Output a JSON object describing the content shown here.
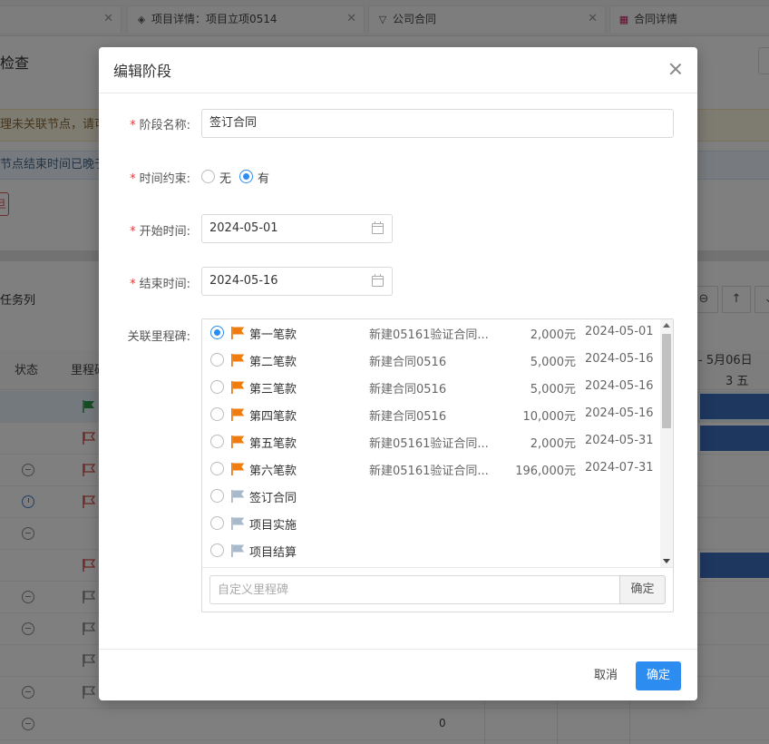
{
  "background": {
    "tabs": [
      {
        "label": ""
      },
      {
        "label": "项目详情：项目立项0514"
      },
      {
        "label": "公司合同"
      },
      {
        "label": "合同详情"
      }
    ],
    "page_title": "检查",
    "warning_text": "理未关联节点，请可",
    "info_text": "节点结束时间已晚于",
    "task_list_label": "任务列",
    "col_status": "状态",
    "col_milestone": "里程碑",
    "date_header": "- 5月06日",
    "day_header": "3  五",
    "bottom_value": "0"
  },
  "modal": {
    "title": "编辑阶段",
    "fields": {
      "stage_name": {
        "label": "阶段名称:",
        "value": "签订合同"
      },
      "time_constraint": {
        "label": "时间约束:",
        "options": [
          {
            "label": "无",
            "selected": false
          },
          {
            "label": "有",
            "selected": true
          }
        ]
      },
      "start_time": {
        "label": "开始时间:",
        "value": "2024-05-01"
      },
      "end_time": {
        "label": "结束时间:",
        "value": "2024-05-16"
      },
      "milestones_label": "关联里程碑:"
    },
    "milestones": [
      {
        "name": "第一笔款",
        "contract": "新建05161验证合同...",
        "amount": "2,000元",
        "date": "2024-05-01",
        "selected": true,
        "flag": "orange-flag-icon"
      },
      {
        "name": "第二笔款",
        "contract": "新建合同0516",
        "amount": "5,000元",
        "date": "2024-05-16",
        "selected": false,
        "flag": "orange-flag-icon"
      },
      {
        "name": "第三笔款",
        "contract": "新建合同0516",
        "amount": "5,000元",
        "date": "2024-05-16",
        "selected": false,
        "flag": "orange-flag-icon"
      },
      {
        "name": "第四笔款",
        "contract": "新建合同0516",
        "amount": "10,000元",
        "date": "2024-05-16",
        "selected": false,
        "flag": "orange-flag-icon"
      },
      {
        "name": "第五笔款",
        "contract": "新建05161验证合同...",
        "amount": "2,000元",
        "date": "2024-05-31",
        "selected": false,
        "flag": "orange-flag-icon"
      },
      {
        "name": "第六笔款",
        "contract": "新建05161验证合同...",
        "amount": "196,000元",
        "date": "2024-07-31",
        "selected": false,
        "flag": "orange-flag-icon"
      },
      {
        "name": "签订合同",
        "contract": "",
        "amount": "",
        "date": "",
        "selected": false,
        "flag": "gray-flag-icon"
      },
      {
        "name": "项目实施",
        "contract": "",
        "amount": "",
        "date": "",
        "selected": false,
        "flag": "gray-flag-icon"
      },
      {
        "name": "项目结算",
        "contract": "",
        "amount": "",
        "date": "",
        "selected": false,
        "flag": "gray-flag-icon"
      }
    ],
    "custom_milestone_placeholder": "自定义里程碑",
    "custom_confirm_label": "确定",
    "cancel_label": "取消",
    "confirm_label": "确定"
  },
  "colors": {
    "primary": "#2d8cf0",
    "required": "#e23b3b",
    "flag_orange": "#f07c0e",
    "flag_gray": "#a9b9cc"
  }
}
